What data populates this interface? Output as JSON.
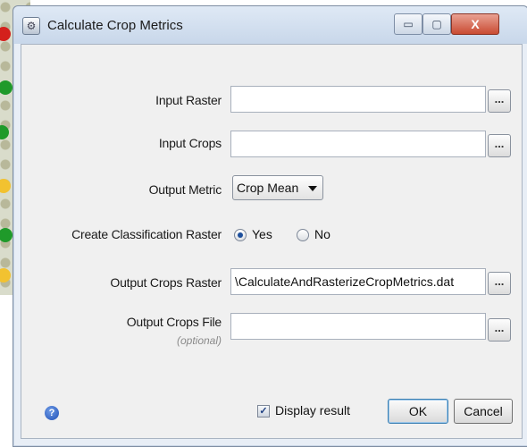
{
  "window": {
    "title": "Calculate Crop Metrics",
    "minimize_glyph": "▭",
    "maximize_glyph": "▢",
    "close_glyph": "X",
    "app_icon": "settings-icon",
    "app_icon_glyph": "⚙"
  },
  "form": {
    "input_raster": {
      "label": "Input Raster",
      "value": "",
      "browse_label": "..."
    },
    "input_crops": {
      "label": "Input Crops",
      "value": "",
      "browse_label": "..."
    },
    "output_metric": {
      "label": "Output Metric",
      "selected": "Crop Mean"
    },
    "create_classification": {
      "label": "Create Classification Raster",
      "options": [
        "Yes",
        "No"
      ],
      "selected": "Yes"
    },
    "output_crops_raster": {
      "label": "Output Crops Raster",
      "value": "\\CalculateAndRasterizeCropMetrics.dat",
      "browse_label": "..."
    },
    "output_crops_file": {
      "label": "Output Crops File",
      "sub_label": "(optional)",
      "value": "",
      "browse_label": "..."
    }
  },
  "footer": {
    "help_icon": "help-icon",
    "help_glyph": "?",
    "display_result_label": "Display result",
    "display_result_checked": true,
    "check_glyph": "✓",
    "ok_label": "OK",
    "cancel_label": "Cancel"
  },
  "colors": {
    "title_bar": "#c8d7ea",
    "close_button": "#c94b32",
    "dialog_body": "#f0f0f0",
    "radio_selected": "#1d4f9c"
  }
}
